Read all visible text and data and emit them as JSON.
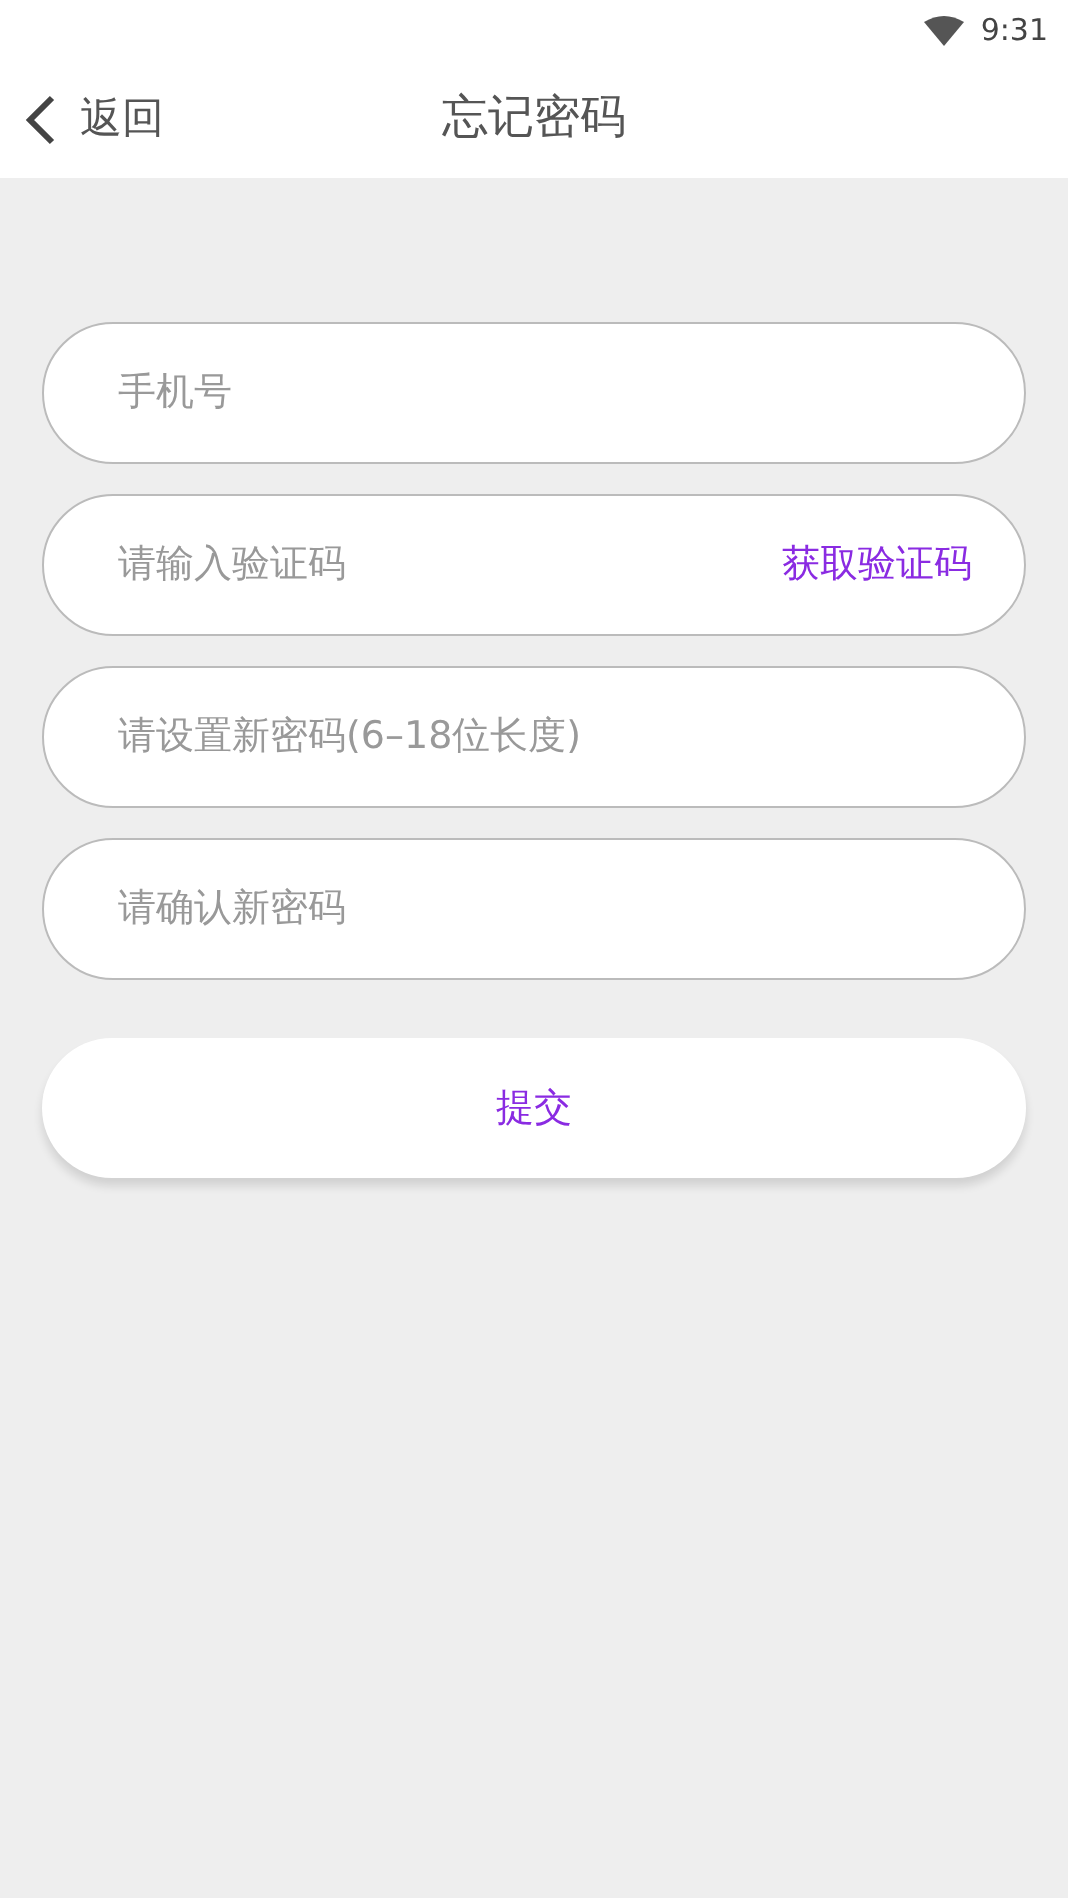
{
  "status_bar": {
    "time": "9:31"
  },
  "header": {
    "back": "返回",
    "title": "忘记密码"
  },
  "fields": [
    {
      "placeholder": "手机号"
    },
    {
      "placeholder": "请输入验证码",
      "action": "获取验证码"
    },
    {
      "placeholder": "请设置新密码(6–18位长度)"
    },
    {
      "placeholder": "请确认新密码"
    }
  ],
  "submit": "提交"
}
